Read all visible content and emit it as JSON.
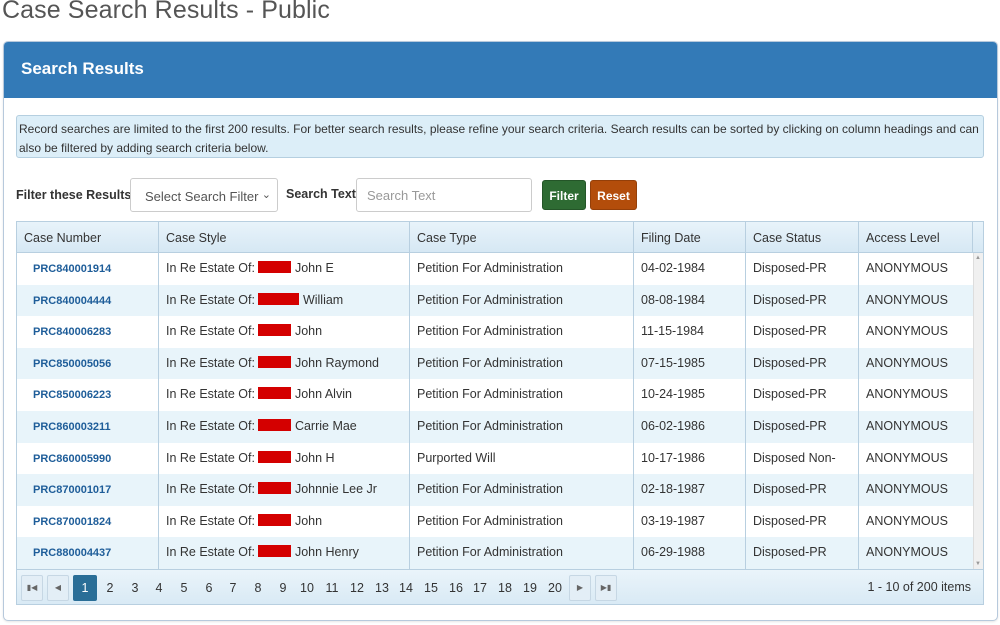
{
  "page_title": "Case Search Results - Public",
  "panel": {
    "heading": "Search Results",
    "info": "Record searches are limited to the first 200 results. For better search results, please refine your search criteria. Search results can be sorted by clicking on column headings and can also be filtered by adding search criteria below."
  },
  "filter": {
    "label": "Filter these Results:",
    "select_value": "Select Search Filter",
    "search_label": "Search Text:",
    "search_placeholder": "Search Text",
    "search_value": "",
    "filter_button": "Filter",
    "reset_button": "Reset"
  },
  "grid": {
    "columns": [
      "Case Number",
      "Case Style",
      "Case Type",
      "Filing Date",
      "Case Status",
      "Access Level"
    ],
    "rows": [
      {
        "case_number": "PRC840001914",
        "style_prefix": "In Re Estate Of:",
        "style_name": "John E",
        "case_type": "Petition For Administration",
        "filing_date": "04-02-1984",
        "status": "Disposed-PR",
        "access": "ANONYMOUS"
      },
      {
        "case_number": "PRC840004444",
        "style_prefix": "In Re Estate Of:",
        "style_name": "William",
        "case_type": "Petition For Administration",
        "filing_date": "08-08-1984",
        "status": "Disposed-PR",
        "access": "ANONYMOUS"
      },
      {
        "case_number": "PRC840006283",
        "style_prefix": "In Re Estate Of:",
        "style_name": "John",
        "case_type": "Petition For Administration",
        "filing_date": "11-15-1984",
        "status": "Disposed-PR",
        "access": "ANONYMOUS"
      },
      {
        "case_number": "PRC850005056",
        "style_prefix": "In Re Estate Of:",
        "style_name": "John Raymond",
        "case_type": "Petition For Administration",
        "filing_date": "07-15-1985",
        "status": "Disposed-PR",
        "access": "ANONYMOUS"
      },
      {
        "case_number": "PRC850006223",
        "style_prefix": "In Re Estate Of:",
        "style_name": "John Alvin",
        "case_type": "Petition For Administration",
        "filing_date": "10-24-1985",
        "status": "Disposed-PR",
        "access": "ANONYMOUS"
      },
      {
        "case_number": "PRC860003211",
        "style_prefix": "In Re Estate Of:",
        "style_name": "Carrie Mae",
        "case_type": "Petition For Administration",
        "filing_date": "06-02-1986",
        "status": "Disposed-PR",
        "access": "ANONYMOUS"
      },
      {
        "case_number": "PRC860005990",
        "style_prefix": "In Re Estate Of:",
        "style_name": "John H",
        "case_type": "Purported Will",
        "filing_date": "10-17-1986",
        "status": "Disposed Non-SRS",
        "access": "ANONYMOUS"
      },
      {
        "case_number": "PRC870001017",
        "style_prefix": "In Re Estate Of:",
        "style_name": "Johnnie Lee Jr",
        "case_type": "Petition For Administration",
        "filing_date": "02-18-1987",
        "status": "Disposed-PR",
        "access": "ANONYMOUS"
      },
      {
        "case_number": "PRC870001824",
        "style_prefix": "In Re Estate Of:",
        "style_name": "John",
        "case_type": "Petition For Administration",
        "filing_date": "03-19-1987",
        "status": "Disposed-PR",
        "access": "ANONYMOUS"
      },
      {
        "case_number": "PRC880004437",
        "style_prefix": "In Re Estate Of:",
        "style_name": "John Henry",
        "case_type": "Petition For Administration",
        "filing_date": "06-29-1988",
        "status": "Disposed-PR",
        "access": "ANONYMOUS"
      }
    ]
  },
  "pager": {
    "pages": [
      "1",
      "2",
      "3",
      "4",
      "5",
      "6",
      "7",
      "8",
      "9",
      "10",
      "11",
      "12",
      "13",
      "14",
      "15",
      "16",
      "17",
      "18",
      "19",
      "20"
    ],
    "current_page": "1",
    "info": "1 - 10 of 200 items",
    "icons": {
      "first": "first-page-icon",
      "prev": "prev-page-icon",
      "next": "next-page-icon",
      "last": "last-page-icon"
    }
  },
  "colors": {
    "header_blue": "#337ab7",
    "filter_green": "#2e6b33",
    "reset_orange": "#b34d0b",
    "redaction_red": "#d40000",
    "link_blue": "#1e5d99",
    "active_page": "#2a6e97"
  }
}
